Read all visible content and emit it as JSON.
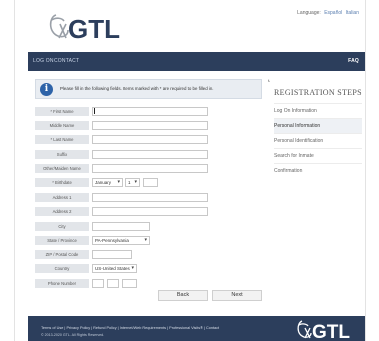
{
  "header": {
    "logo_text": "GTL",
    "language_label": "Language:",
    "language_options": [
      "Español",
      "Italian"
    ]
  },
  "nav": {
    "items": [
      "LOG ON",
      "CONTACT"
    ],
    "faq": "FAQ"
  },
  "notice": {
    "text": "Please fill in the following fields. Items marked with * are required to be filled in."
  },
  "form": {
    "rows": [
      {
        "label": "* First Name",
        "value": ""
      },
      {
        "label": "Middle Name",
        "value": ""
      },
      {
        "label": "* Last Name",
        "value": ""
      },
      {
        "label": "Suffix",
        "value": ""
      },
      {
        "label": "Other/Maiden Name",
        "value": ""
      },
      {
        "label": "* Birthdate",
        "month": "January",
        "day": "1",
        "year": ""
      },
      {
        "label": "Address 1",
        "value": ""
      },
      {
        "label": "Address 2",
        "value": ""
      },
      {
        "label": "City",
        "value": ""
      },
      {
        "label": "State / Province",
        "value": "PA-Pennsylvania"
      },
      {
        "label": "ZIP / Postal Code",
        "value": ""
      },
      {
        "label": "Country",
        "value": "US-United States"
      },
      {
        "label": "Phone Number",
        "value": ""
      }
    ],
    "back_label": "Back",
    "next_label": "Next"
  },
  "side": {
    "title": "REGISTRATION STEPS",
    "steps": [
      {
        "label": "Log On Information"
      },
      {
        "label": "Personal Information",
        "active": true
      },
      {
        "label": "Personal Identification"
      },
      {
        "label": "Search for Inmate"
      },
      {
        "label": "Confirmation"
      }
    ]
  },
  "footer": {
    "links": "Terms of Use | Privacy Policy | Refund Policy | Internet/Web Requirements | Professional Visits® | Contact",
    "copyright": "© 2013-2020 GTL. All Rights Reserved."
  },
  "colors": {
    "brand_navy": "#2c3e5c",
    "info_blue": "#2e63a8",
    "logo_gray": "#9aa0a8"
  }
}
